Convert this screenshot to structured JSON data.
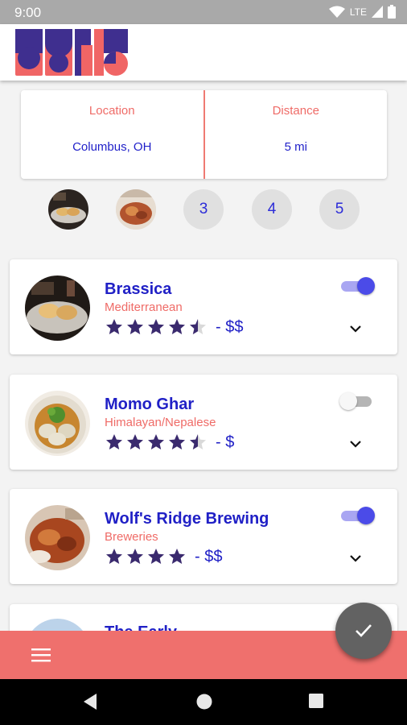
{
  "status_bar": {
    "time": "9:00",
    "network": "LTE"
  },
  "filters": {
    "location": {
      "label": "Location",
      "value": "Columbus, OH"
    },
    "distance": {
      "label": "Distance",
      "value": "5 mi"
    }
  },
  "pager": {
    "pages": [
      "3",
      "4",
      "5"
    ]
  },
  "restaurants": [
    {
      "name": "Brassica",
      "cuisine": "Mediterranean",
      "rating": 4.5,
      "price": "- $$",
      "selected": true
    },
    {
      "name": "Momo Ghar",
      "cuisine": "Himalayan/Nepalese",
      "rating": 4.5,
      "price": "- $",
      "selected": false
    },
    {
      "name": "Wolf's Ridge Brewing",
      "cuisine": "Breweries",
      "rating": 4,
      "price": "- $$",
      "selected": true
    },
    {
      "name": "The Early",
      "cuisine": "",
      "rating": 0,
      "price": "",
      "selected": false
    }
  ],
  "icons": {
    "menu": "menu-icon",
    "confirm": "check-icon",
    "expand": "chevron-down-icon"
  },
  "colors": {
    "accent_blue": "#2020c6",
    "coral": "#ef706d",
    "toggle_on": "#4b4be8",
    "star": "#3a2a6e"
  }
}
